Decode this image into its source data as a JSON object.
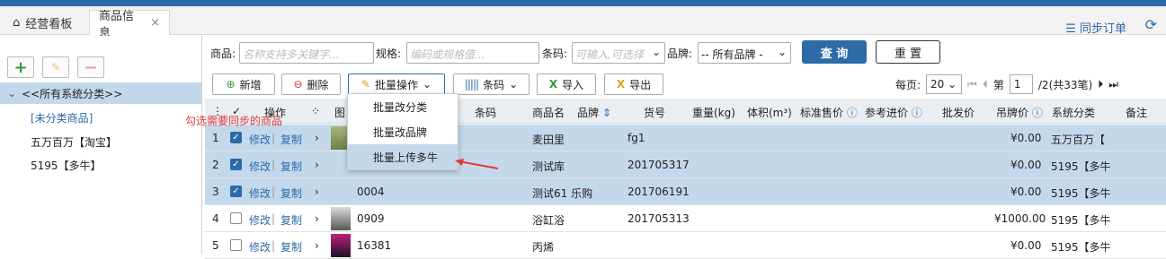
{
  "tabs": {
    "home_label": "经营看板",
    "active_label": "商品信息",
    "close_glyph": "×",
    "sync_label": "同步订单"
  },
  "tree": {
    "root": "<<所有系统分类>>",
    "items": [
      "[未分类商品]",
      "五万百万【淘宝】",
      "5195【多牛】"
    ]
  },
  "search": {
    "goods_label": "商品:",
    "goods_placeholder": "名称支持多关键字...",
    "spec_label": "规格:",
    "spec_placeholder": "编码或规格值...",
    "barcode_label": "条码:",
    "barcode_placeholder": "可输入,可选择",
    "brand_label": "品牌:",
    "brand_value": "-- 所有品牌 -",
    "query": "查 询",
    "reset": "重 置"
  },
  "toolbar": {
    "add": "新增",
    "delete": "删除",
    "batch": "批量操作",
    "barcode": "条码",
    "import": "导入",
    "export": "导出",
    "per_page_label": "每页:",
    "per_page_value": "20",
    "page_label": "第",
    "page_value": "1",
    "page_total": "/2(共33笔)"
  },
  "dropdown": {
    "items": [
      "批量改分类",
      "批量改品牌",
      "批量上传多牛"
    ]
  },
  "annotation": "勾选需要同步的商品",
  "columns": {
    "op": "操作",
    "img": "图",
    "barcode": "条码",
    "name": "商品名",
    "brand": "品牌",
    "sku": "货号",
    "weight": "重量(kg)",
    "volume": "体积(m³)",
    "std_price": "标准售价",
    "ref_price": "参考进价",
    "wholesale": "批发价",
    "tag_price": "吊牌价",
    "category": "系统分类",
    "note": "备注"
  },
  "rows": [
    {
      "no": "1",
      "checked": true,
      "edit": "修改",
      "copy": "复制",
      "barcode": "",
      "name": "麦田里",
      "sku": "fg1",
      "tag_price": "¥0.00",
      "category": "五万百万【"
    },
    {
      "no": "2",
      "checked": true,
      "edit": "修改",
      "copy": "复制",
      "barcode": "",
      "name": "测试库",
      "sku": "201705317",
      "tag_price": "¥0.00",
      "category": "5195【多牛"
    },
    {
      "no": "3",
      "checked": true,
      "edit": "修改",
      "copy": "复制",
      "barcode": "0004",
      "name": "测试61 乐购",
      "sku": "201706191",
      "tag_price": "¥0.00",
      "category": "5195【多牛"
    },
    {
      "no": "4",
      "checked": false,
      "edit": "修改",
      "copy": "复制",
      "barcode": "0909",
      "name": "浴缸浴",
      "sku": "201705313",
      "tag_price": "¥1000.00",
      "category": "5195【多牛"
    },
    {
      "no": "5",
      "checked": false,
      "edit": "修改",
      "copy": "复制",
      "barcode": "16381",
      "name": "丙烯",
      "sku": "",
      "tag_price": "¥0.00",
      "category": "5195【多牛"
    }
  ]
}
